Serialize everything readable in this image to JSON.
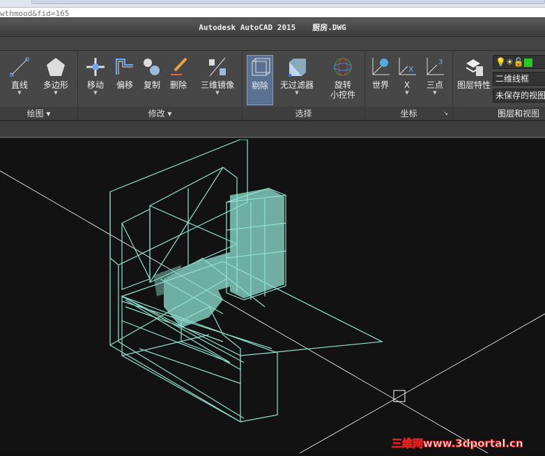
{
  "browser": {
    "url_fragment": "wthmood&fid=165"
  },
  "title": {
    "app": "Autodesk AutoCAD 2015",
    "file": "厨房.DWG"
  },
  "panels": [
    {
      "label": "绘图",
      "buttons": [
        "直线",
        "多边形"
      ]
    },
    {
      "label": "修改",
      "buttons": [
        "移动",
        "偏移",
        "复制",
        "删除",
        "三维镜像"
      ]
    },
    {
      "label": "选择",
      "buttons": [
        "剔除",
        "无过滤器",
        "旋转",
        "小控件"
      ]
    },
    {
      "label": "坐标",
      "buttons": [
        "世界",
        "X",
        "三点"
      ]
    },
    {
      "label": "图层和视图",
      "buttons": [
        "图层特性"
      ]
    }
  ],
  "layer_controls": {
    "visual_style": "二维线框",
    "view": "未保存的视图"
  },
  "panel_label_5": "图层和",
  "watermark": "三维网www.3dportal.cn",
  "colors": {
    "wire": "#8fe3d2",
    "active": "#5a7192"
  }
}
